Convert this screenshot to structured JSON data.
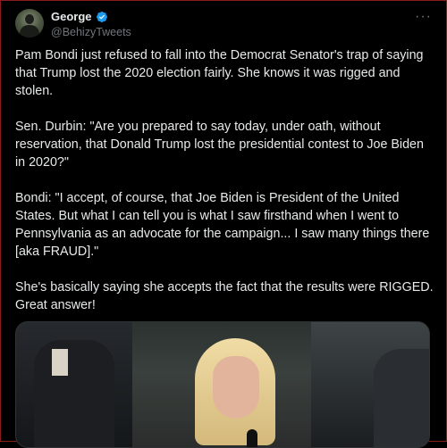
{
  "post": {
    "author": {
      "display_name": "George",
      "handle": "@BehizyTweets",
      "verified": true
    },
    "more_icon": "more-horizontal-icon",
    "paragraphs": [
      "Pam Bondi just refused to fall into the Democrat Senator's trap of saying that Trump lost the 2020 election fairly. She knows it was rigged and stolen.",
      "Sen. Durbin: \"Are you prepared to say today, under oath, without reservation, that Donald Trump lost the presidential contest to Joe Biden in 2020?\"",
      "Bondi: \"I accept, of course, that Joe Biden is President of the United States. But what I can tell you is what I saw firsthand when I went to Pennsylvania as an advocate for the campaign... I saw many things there [aka FRAUD].\"",
      "She's basically saying she accepts the fact that the results were RIGGED. Great answer!"
    ]
  },
  "colors": {
    "background": "#000000",
    "text": "#e7e9ea",
    "secondary": "#71767b",
    "verified_blue": "#1d9bf0"
  }
}
